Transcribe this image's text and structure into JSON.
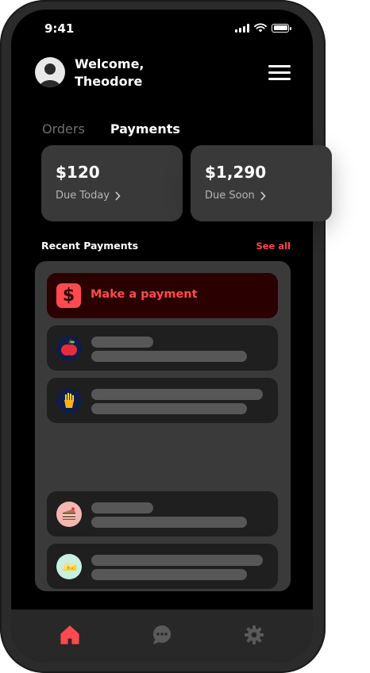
{
  "status_bar": {
    "time": "9:41"
  },
  "header": {
    "welcome_line1": "Welcome,",
    "welcome_line2": "Theodore"
  },
  "tabs": [
    {
      "label": "Orders",
      "active": false
    },
    {
      "label": "Payments",
      "active": true
    }
  ],
  "cards": [
    {
      "amount": "$120",
      "label": "Due Today"
    },
    {
      "amount": "$1,290",
      "label": "Due Soon"
    }
  ],
  "recent_payments": {
    "title": "Recent Payments",
    "see_all": "See all",
    "make_payment_label": "Make a payment",
    "items": [
      {
        "icon": "apple-icon"
      },
      {
        "icon": "fries-icon"
      },
      {
        "icon": "cake-icon"
      },
      {
        "icon": "cheese-icon"
      }
    ]
  },
  "bottom_nav": [
    {
      "icon": "home-icon",
      "active": true
    },
    {
      "icon": "chat-icon",
      "active": false
    },
    {
      "icon": "gear-icon",
      "active": false
    }
  ],
  "colors": {
    "accent": "#ff4b4f",
    "background": "#000000",
    "card": "#393939",
    "panel": "#3a3a3a",
    "row": "#1f1f1f",
    "make_payment_bg": "#2b0000",
    "nav_bg": "#282828"
  }
}
